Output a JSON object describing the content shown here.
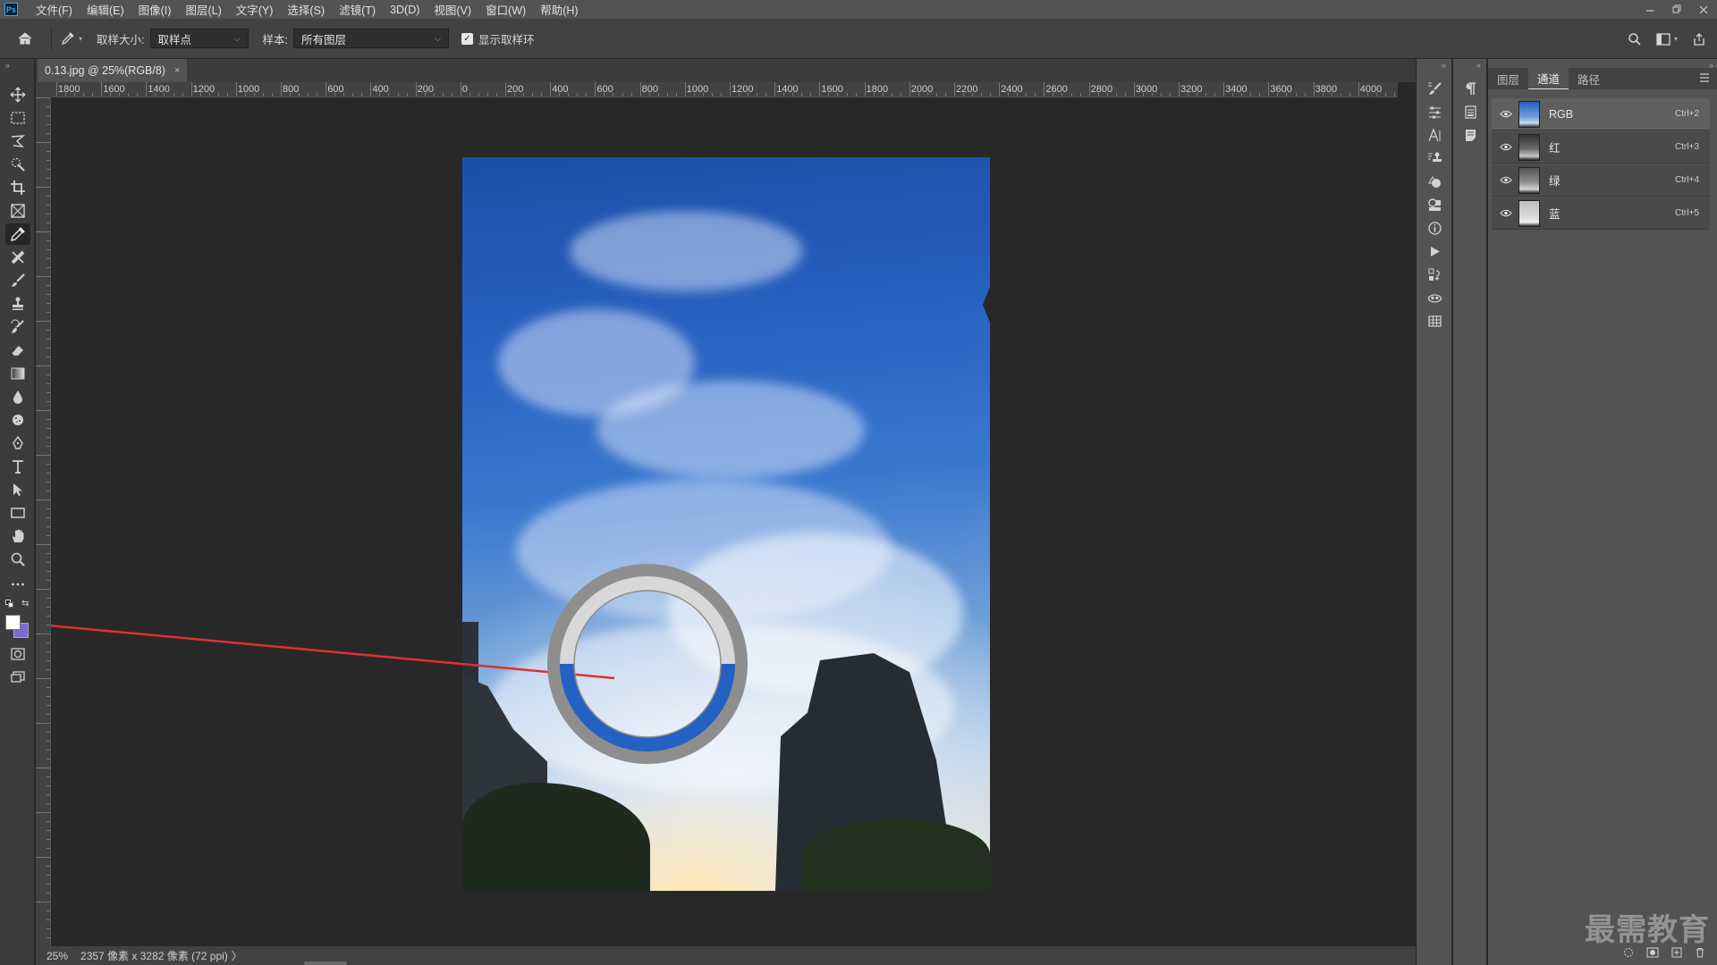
{
  "menubar": {
    "logo": "Ps",
    "items": [
      "文件(F)",
      "编辑(E)",
      "图像(I)",
      "图层(L)",
      "文字(Y)",
      "选择(S)",
      "滤镜(T)",
      "3D(D)",
      "视图(V)",
      "窗口(W)",
      "帮助(H)"
    ],
    "window_controls": [
      "minimize",
      "restore",
      "close"
    ]
  },
  "options": {
    "sample_size_label": "取样大小:",
    "sample_size_value": "取样点",
    "sample_label": "样本:",
    "sample_value": "所有图层",
    "show_ring_label": "显示取样环",
    "show_ring_checked": true
  },
  "document": {
    "tab_title": "0.13.jpg @ 25%(RGB/8)",
    "tab_close": "×"
  },
  "ruler": {
    "h_labels": [
      "1800",
      "1600",
      "1400",
      "1200",
      "1000",
      "800",
      "600",
      "400",
      "200",
      "0",
      "200",
      "400",
      "600",
      "800",
      "1000",
      "1200",
      "1400",
      "1600",
      "1800",
      "2000",
      "2200",
      "2400",
      "2600",
      "2800",
      "3000",
      "3200",
      "3400",
      "3600",
      "3800",
      "4000"
    ]
  },
  "status": {
    "zoom": "25%",
    "info": "2357 像素 x 3282 像素 (72 ppi)",
    "arrow": "〉"
  },
  "color_sampler": {
    "foreground": "#ffffff",
    "background": "#7a6bd6",
    "ring_outer": "#8e8e8e",
    "ring_color_top": "#d8d8d8",
    "ring_color_bottom": "#2461c2",
    "pointer_line": "#e03030"
  },
  "panel": {
    "tabs": [
      "图层",
      "通道",
      "路径"
    ],
    "active_tab": "通道",
    "channels": [
      {
        "name": "RGB",
        "shortcut": "Ctrl+2"
      },
      {
        "name": "红",
        "shortcut": "Ctrl+3"
      },
      {
        "name": "绿",
        "shortcut": "Ctrl+4"
      },
      {
        "name": "蓝",
        "shortcut": "Ctrl+5"
      }
    ]
  },
  "watermark": "最需教育"
}
